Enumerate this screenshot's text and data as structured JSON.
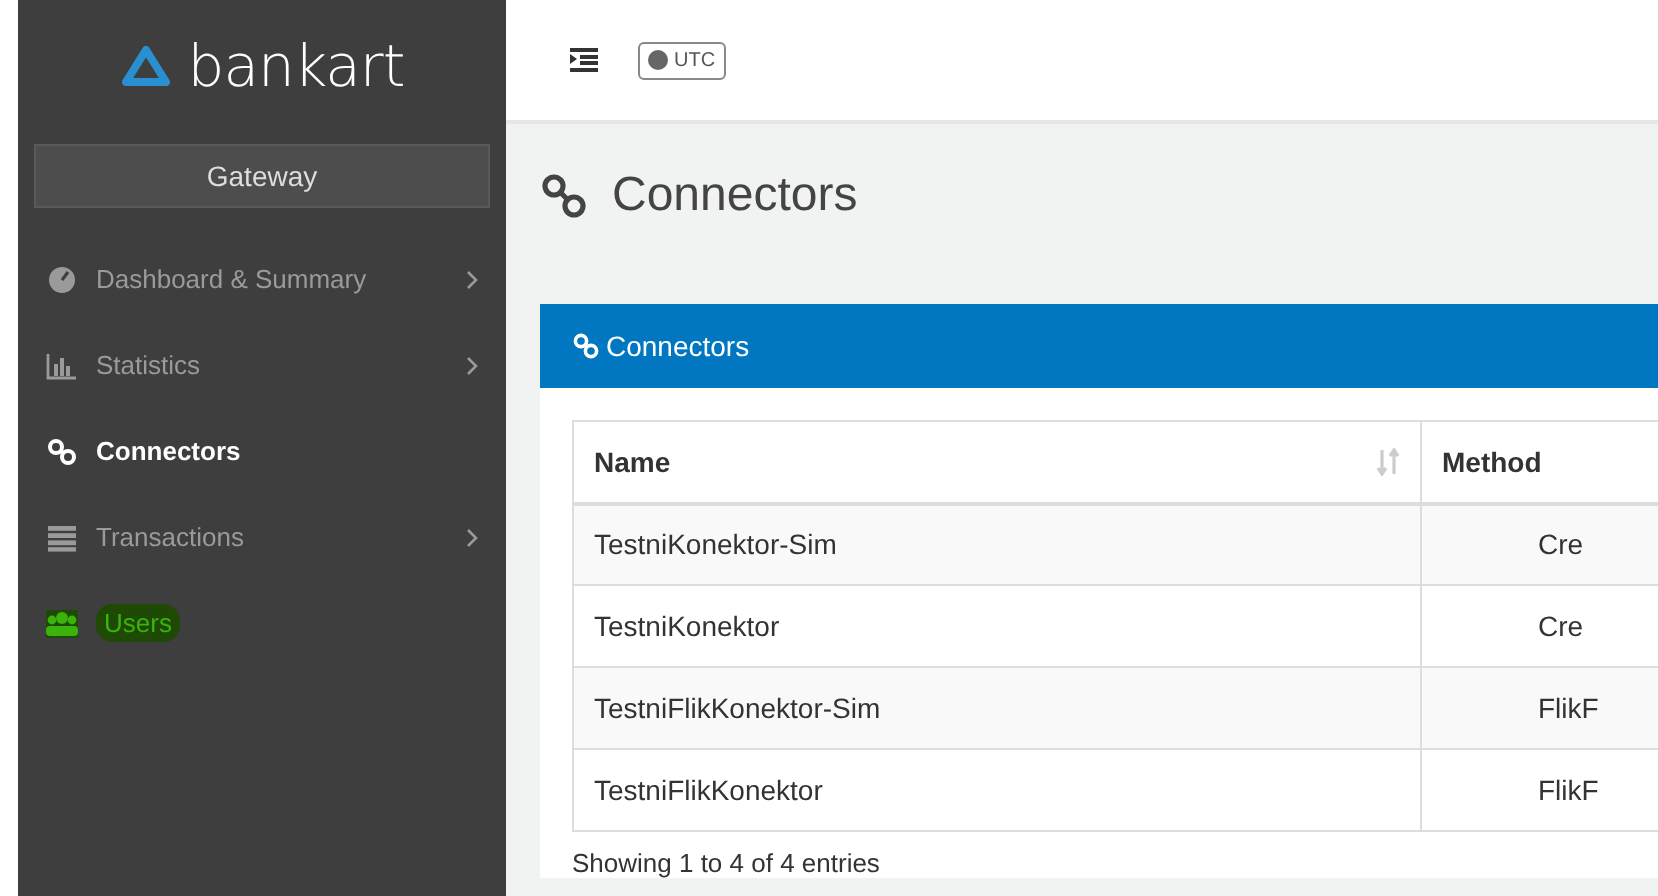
{
  "sidebar": {
    "logo": "bankart",
    "context_button": "Gateway",
    "items": [
      {
        "label": "Dashboard & Summary",
        "selected": false,
        "has_submenu": true,
        "highlighted": false
      },
      {
        "label": "Statistics",
        "selected": false,
        "has_submenu": true,
        "highlighted": false
      },
      {
        "label": "Connectors",
        "selected": true,
        "has_submenu": false,
        "highlighted": false
      },
      {
        "label": "Transactions",
        "selected": false,
        "has_submenu": true,
        "highlighted": false
      },
      {
        "label": "Users",
        "selected": false,
        "has_submenu": false,
        "highlighted": true
      }
    ]
  },
  "topbar": {
    "timezone": "UTC"
  },
  "page_title": "Connectors",
  "panel": {
    "title": "Connectors",
    "table": {
      "columns": [
        "Name",
        "Method"
      ],
      "rows": [
        [
          "TestniKonektor-Sim",
          "Cre"
        ],
        [
          "TestniKonektor",
          "Cre"
        ],
        [
          "TestniFlikKonektor-Sim",
          "FlikF"
        ],
        [
          "TestniFlikKonektor",
          "FlikF"
        ]
      ]
    },
    "footer": "Showing 1 to 4 of 4 entries"
  }
}
